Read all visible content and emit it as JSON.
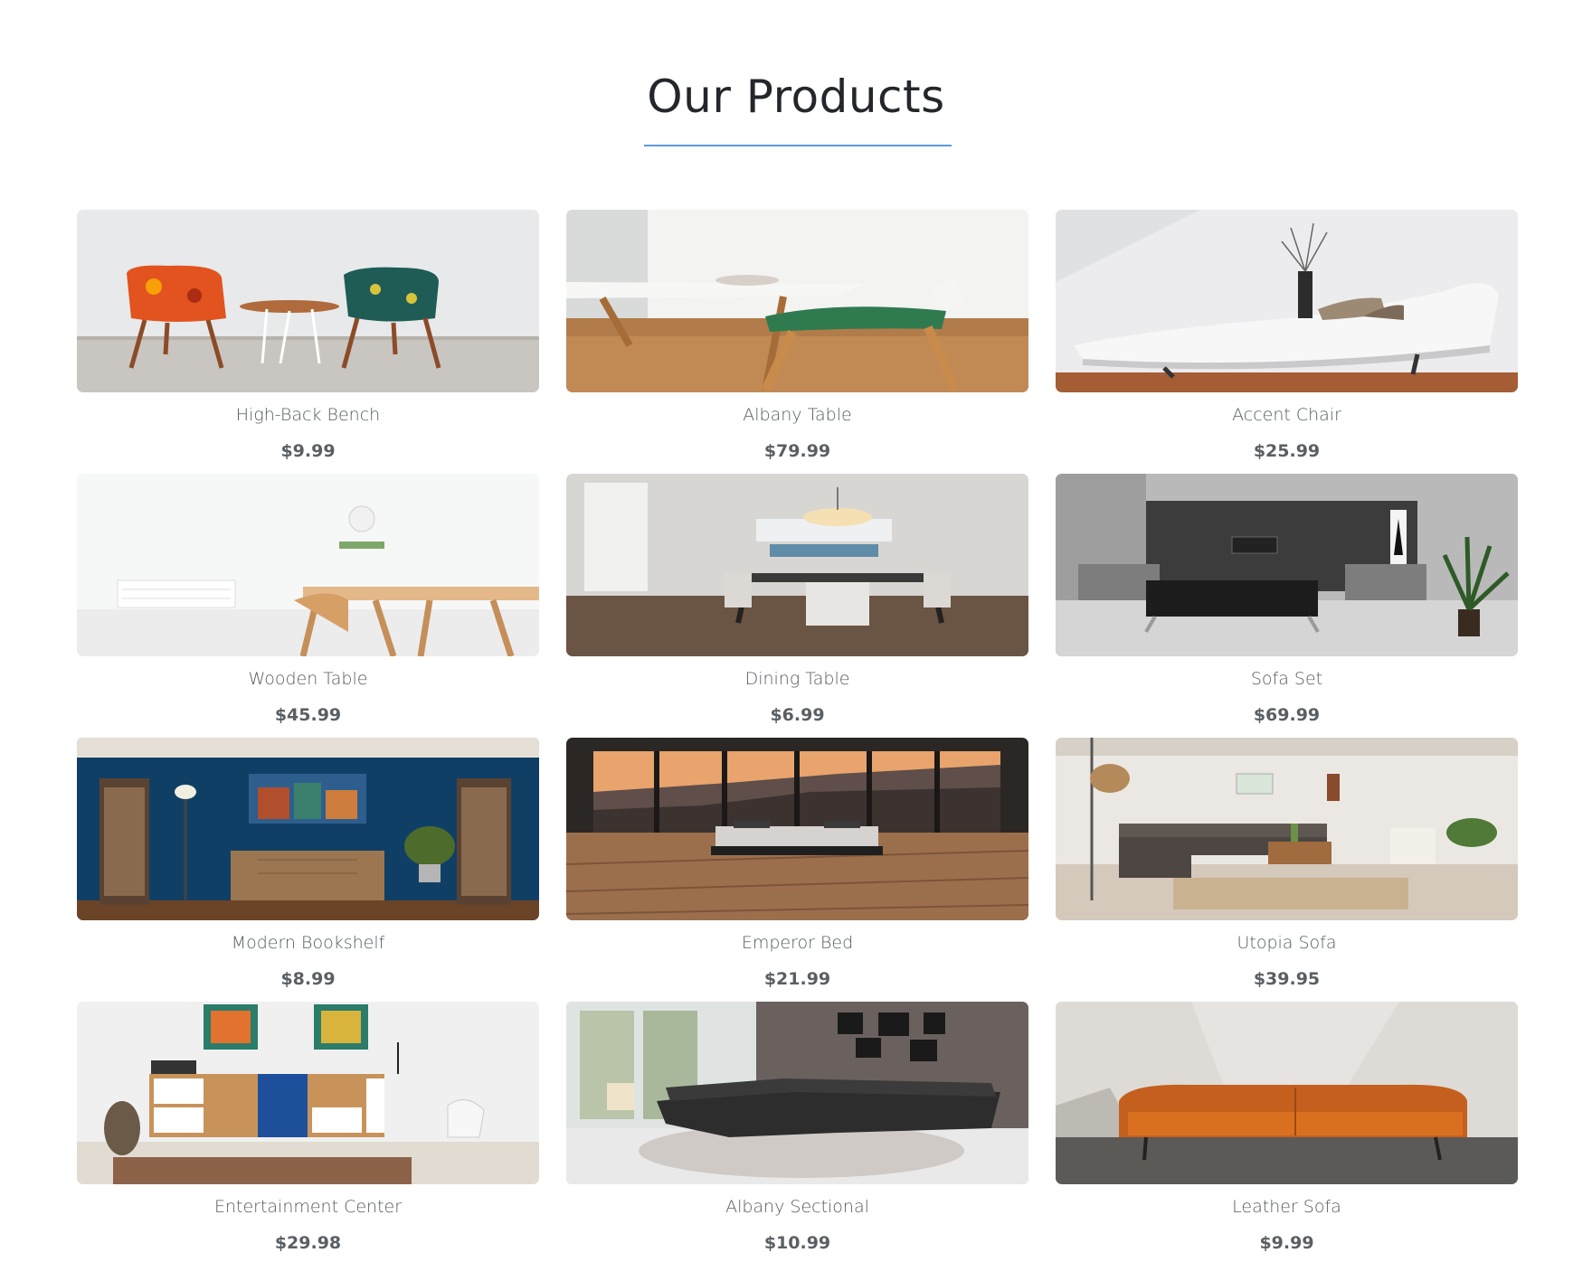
{
  "header": {
    "title": "Our Products",
    "accent_color": "#5b9be6"
  },
  "products": [
    {
      "name": "High-Back Bench",
      "price": "$9.99",
      "image": "two-patterned-chairs-photo"
    },
    {
      "name": "Albany Table",
      "price": "$79.99",
      "image": "dining-table-chair-photo"
    },
    {
      "name": "Accent Chair",
      "price": "$25.99",
      "image": "white-chaise-lounge-photo"
    },
    {
      "name": "Wooden Table",
      "price": "$45.99",
      "image": "bright-room-wooden-table-photo"
    },
    {
      "name": "Dining Table",
      "price": "$6.99",
      "image": "dining-room-photo"
    },
    {
      "name": "Sofa Set",
      "price": "$69.99",
      "image": "modern-living-room-sofa-photo"
    },
    {
      "name": "Modern Bookshelf",
      "price": "$8.99",
      "image": "blue-room-bookshelf-photo"
    },
    {
      "name": "Emperor Bed",
      "price": "$21.99",
      "image": "bed-mountain-view-photo"
    },
    {
      "name": "Utopia Sofa",
      "price": "$39.95",
      "image": "living-room-sectional-photo"
    },
    {
      "name": "Entertainment Center",
      "price": "$29.98",
      "image": "shelving-unit-photo"
    },
    {
      "name": "Albany Sectional",
      "price": "$10.99",
      "image": "black-sectional-photo"
    },
    {
      "name": "Leather Sofa",
      "price": "$9.99",
      "image": "orange-leather-sofa-photo"
    }
  ]
}
